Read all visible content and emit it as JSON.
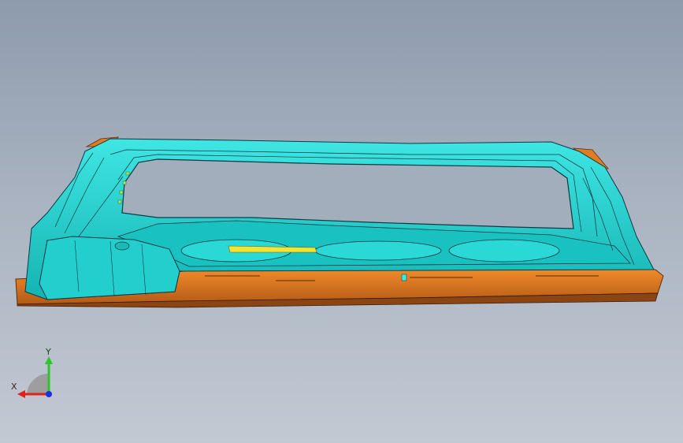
{
  "viewport": {
    "content": "3d-cad-model-door-inner-panel",
    "colors": {
      "surface_cyan": "#1fd3d0",
      "surface_cyan_dark": "#12a9a8",
      "edge_lines": "#0b3a44",
      "flange_orange": "#d9731e",
      "flange_orange_dark": "#8a4512",
      "yellow_detail": "#f2e437"
    }
  },
  "triad": {
    "x_label": "X",
    "y_label": "Y",
    "colors": {
      "x": "#e0201a",
      "y": "#2ec42e",
      "z": "#1a2fe0",
      "base": "#9a9a9a"
    }
  }
}
